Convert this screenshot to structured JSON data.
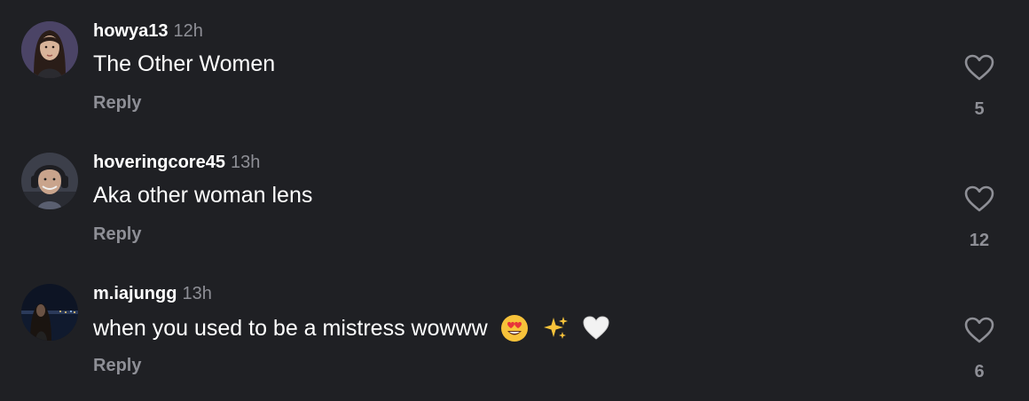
{
  "comments": [
    {
      "username": "howya13",
      "time": "12h",
      "text": "The Other Women",
      "reply_label": "Reply",
      "likes": "5",
      "avatar_icon": "avatar-woman-dark-hair"
    },
    {
      "username": "hoveringcore45",
      "time": "13h",
      "text": "Aka other woman lens",
      "reply_label": "Reply",
      "likes": "12",
      "avatar_icon": "avatar-man-headphones"
    },
    {
      "username": "m.iajungg",
      "time": "13h",
      "text": "when you used to be a mistress wowww",
      "emojis": [
        "heart-eyes-emoji",
        "sparkles-emoji",
        "white-heart-emoji"
      ],
      "reply_label": "Reply",
      "likes": "6",
      "avatar_icon": "avatar-night-city"
    }
  ],
  "colors": {
    "background": "#1f2024",
    "primary_text": "#ffffff",
    "secondary_text": "#8e8f96"
  }
}
